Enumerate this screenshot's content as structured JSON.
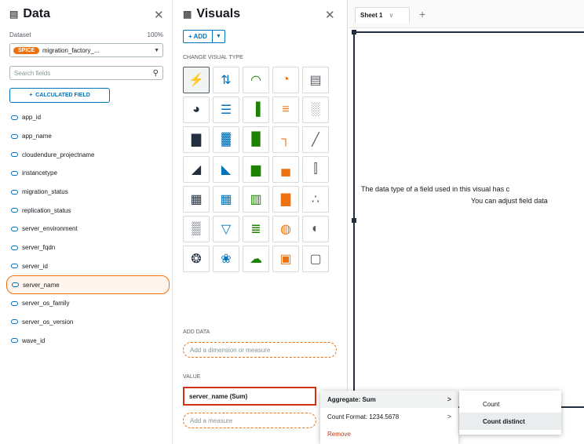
{
  "data_panel": {
    "title": "Data",
    "icon": "table-icon",
    "dataset_label": "Dataset",
    "spice_usage": "100%",
    "spice_badge": "SPICE",
    "dataset_name": "migration_factory_...",
    "search_placeholder": "Search fields",
    "calc_field_label": "CALCULATED FIELD",
    "fields": [
      {
        "label": "app_id"
      },
      {
        "label": "app_name"
      },
      {
        "label": "cloudendure_projectname"
      },
      {
        "label": "instancetype"
      },
      {
        "label": "migration_status"
      },
      {
        "label": "replication_status"
      },
      {
        "label": "server_environment"
      },
      {
        "label": "server_fqdn"
      },
      {
        "label": "server_id"
      },
      {
        "label": "server_name",
        "selected": true
      },
      {
        "label": "server_os_family"
      },
      {
        "label": "server_os_version"
      },
      {
        "label": "wave_id"
      }
    ]
  },
  "visuals_panel": {
    "title": "Visuals",
    "add_label": "+ ADD",
    "change_visual_type_label": "CHANGE VISUAL TYPE",
    "visual_types": [
      "autograph-icon",
      "vertical-bar-icon",
      "gauge-icon",
      "donut-icon",
      "kpi-icon",
      "pie-icon",
      "horizontal-bar-icon",
      "clustered-bar-icon",
      "stacked-horizontal-bar-icon",
      "waterfall-icon",
      "stacked-bar-icon",
      "stacked-percent-bar-icon",
      "stacked-column-icon",
      "step-icon",
      "line-icon",
      "area-icon",
      "stacked-area-icon",
      "combo-bar-icon",
      "combo-line-icon",
      "boxplot-icon",
      "pivot-icon",
      "table-icon",
      "treemap-icon",
      "histogram-icon",
      "scatter-icon",
      "tower-icon",
      "funnel-icon",
      "sankey-icon",
      "filled-map-icon",
      "globe-icon",
      "heatmap-icon",
      "insight-icon",
      "word-cloud-icon",
      "custom-icon",
      "blank-icon"
    ],
    "add_data_label": "ADD DATA",
    "add_dimension_placeholder": "Add a dimension or measure",
    "value_label": "VALUE",
    "value_field": "server_name (Sum)",
    "add_measure_placeholder": "Add a measure"
  },
  "sheet": {
    "tab_label": "Sheet 1",
    "message_line1": "The data type of a field used in this visual has c",
    "message_line2": "You can adjust field data"
  },
  "field_menu": {
    "items": [
      {
        "label": "Aggregate: Sum",
        "arrow": ">"
      },
      {
        "label": "Count Format: 1234.5678",
        "arrow": ">"
      },
      {
        "label": "Remove"
      }
    ]
  },
  "aggregate_submenu": {
    "items": [
      {
        "label": "Count"
      },
      {
        "label": "Count distinct"
      }
    ]
  }
}
